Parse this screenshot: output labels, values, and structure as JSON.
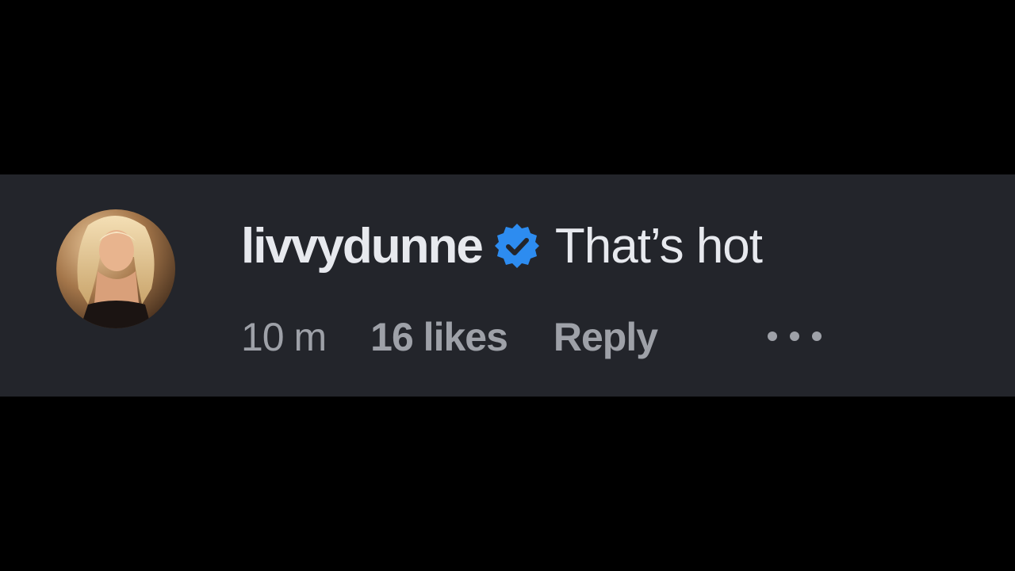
{
  "comment": {
    "username": "livvydunne",
    "verified_icon": "verified-badge-icon",
    "text": "That’s hot",
    "time": "10 m",
    "likes": "16 likes",
    "reply_label": "Reply",
    "more_icon": "more-options-icon"
  },
  "colors": {
    "page_background": "#000000",
    "comment_background": "#23252b",
    "primary_text": "#e7e9ee",
    "secondary_text": "#9ea1a8",
    "verified_blue": "#2d8cf0"
  }
}
